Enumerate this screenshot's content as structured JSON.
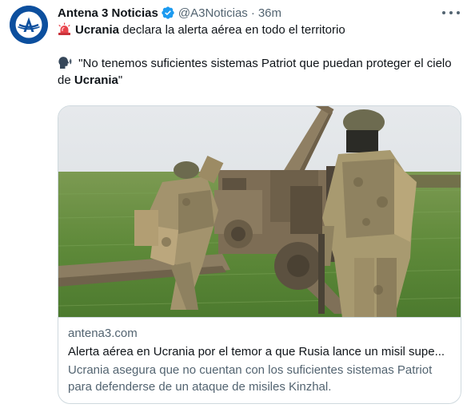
{
  "tweet": {
    "author": {
      "display_name": "Antena 3 Noticias",
      "handle": "@A3Noticias",
      "verified_icon": "verified-badge-icon",
      "avatar_icon": "antena3-logo-icon"
    },
    "separator": "·",
    "timestamp": "36m",
    "more_icon": "more-options-icon",
    "text": {
      "line1_emoji": "siren-emoji",
      "line1_bold": "Ucrania",
      "line1_rest": " declara la alerta aérea en todo el territorio",
      "line2_emoji": "speaking-head-emoji",
      "line2_text": " \"No tenemos suficientes sistemas Patriot que puedan proteger el cielo",
      "line3_prefix": "de ",
      "line3_bold": "Ucrania",
      "line3_suffix": "\""
    },
    "card": {
      "domain": "antena3.com",
      "title": "Alerta aérea en Ucrania por el temor a que Rusia lance un misil supe...",
      "description_line1": "Ucrania asegura que no cuentan con los suficientes sistemas Patriot",
      "description_line2": "para defenderse de un ataque de misiles Kinzhal."
    },
    "colors": {
      "text": "#0f1419",
      "secondary": "#536471",
      "border": "#cfd9de",
      "verified": "#1d9bf0",
      "brand": "#0c4f9e"
    }
  }
}
